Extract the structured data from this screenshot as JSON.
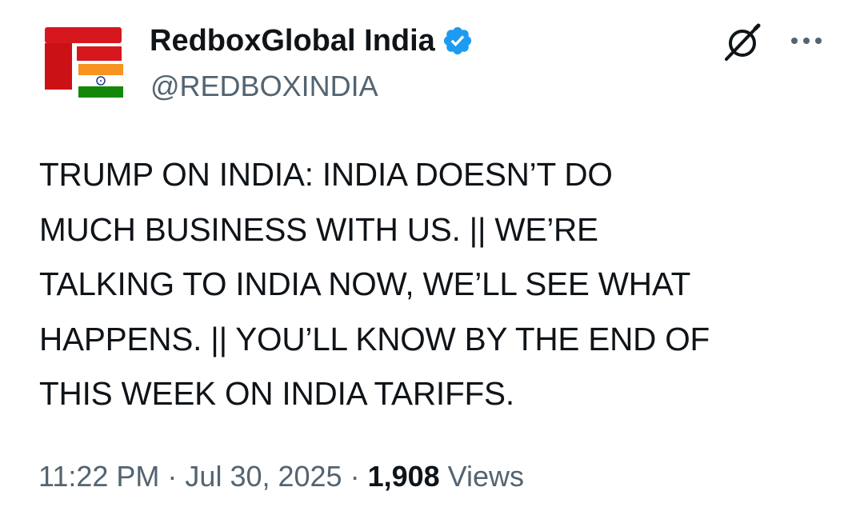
{
  "author": {
    "display_name": "RedboxGlobal India",
    "handle": "@REDBOXINDIA",
    "verified": true,
    "avatar_icon": "redbox-flag-logo-icon"
  },
  "icons": {
    "grok": "grok-icon",
    "more": "more-options-icon",
    "verified": "verified-badge-icon"
  },
  "tweet": {
    "text": "TRUMP ON INDIA: INDIA DOESN’T DO\nMUCH BUSINESS WITH US. || WE’RE\nTALKING TO INDIA NOW, WE’LL SEE WHAT\nHAPPENS. || YOU’LL KNOW BY THE END OF\nTHIS WEEK ON INDIA TARIFFS."
  },
  "meta": {
    "time": "11:22 PM",
    "separator": " · ",
    "date": "Jul 30, 2025",
    "views_count": "1,908",
    "views_label": " Views"
  },
  "colors": {
    "text_primary": "#0f1419",
    "text_secondary": "#536471",
    "verified_blue": "#1d9bf0",
    "brand_red": "#d6181e",
    "saffron": "#f7931e",
    "india_green": "#138808"
  }
}
